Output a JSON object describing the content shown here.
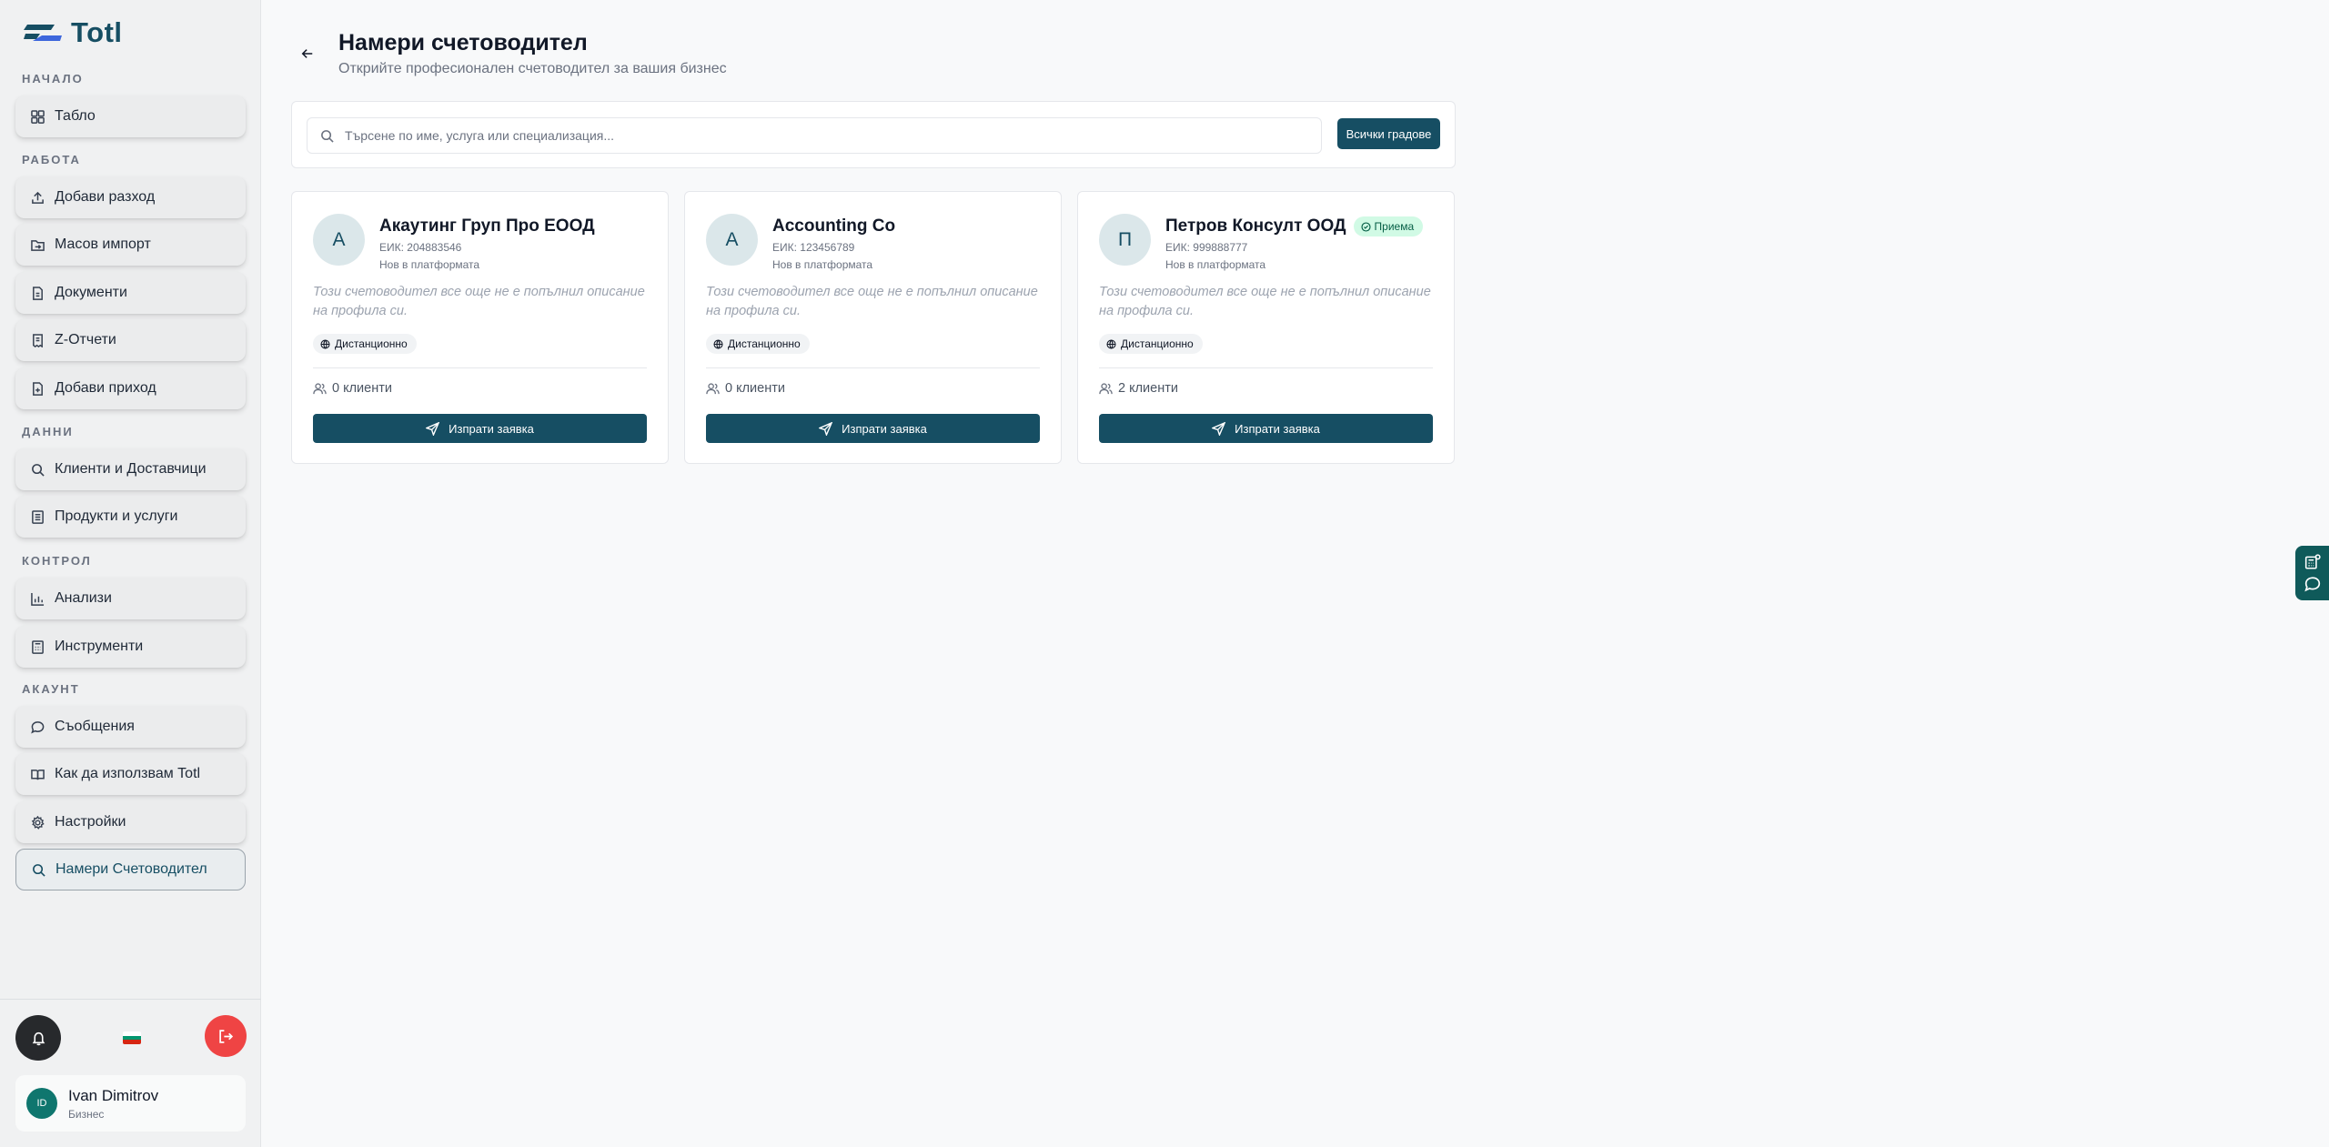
{
  "app": {
    "logo_text": "Totl",
    "brand_color": "#164e63"
  },
  "sidebar": {
    "sections": [
      "НАЧАЛО",
      "РАБОТА",
      "ДАННИ",
      "КОНТРОЛ",
      "АКАУНТ"
    ],
    "items": [
      {
        "label": "Табло",
        "icon": "dashboard-icon"
      },
      {
        "label": "Добави разход",
        "icon": "upload-icon"
      },
      {
        "label": "Масов импорт",
        "icon": "folder-import-icon"
      },
      {
        "label": "Документи",
        "icon": "document-icon"
      },
      {
        "label": "Z-Отчети",
        "icon": "receipt-icon"
      },
      {
        "label": "Добави приход",
        "icon": "document-plus-icon"
      },
      {
        "label": "Клиенти и Доставчици",
        "icon": "search-icon"
      },
      {
        "label": "Продукти и услуги",
        "icon": "list-icon"
      },
      {
        "label": "Анализи",
        "icon": "bar-chart-icon"
      },
      {
        "label": "Инструменти",
        "icon": "calculator-icon"
      },
      {
        "label": "Съобщения",
        "icon": "message-icon"
      },
      {
        "label": "Как да използвам Totl",
        "icon": "book-icon"
      },
      {
        "label": "Настройки",
        "icon": "gear-icon"
      },
      {
        "label": "Намери Счетоводител",
        "icon": "search-icon",
        "active": true
      }
    ]
  },
  "user": {
    "initials": "ID",
    "name": "Ivan Dimitrov",
    "role": "Бизнес"
  },
  "header": {
    "title": "Намери счетоводител",
    "subtitle": "Открийте професионален счетоводител за вашия бизнес"
  },
  "search": {
    "placeholder": "Търсене по име, услуга или специализация...",
    "city_filter": "Всички градове"
  },
  "cards": [
    {
      "initial": "А",
      "name": "Акаутинг Груп Про ЕООД",
      "eik": "ЕИК: 204883546",
      "status": "Нов в платформата",
      "description": "Този счетоводител все още не е попълнил описание на профила си.",
      "tag": "Дистанционно",
      "clients": "0 клиенти",
      "button": "Изпрати заявка"
    },
    {
      "initial": "A",
      "name": "Accounting Co",
      "eik": "ЕИК: 123456789",
      "status": "Нов в платформата",
      "description": "Този счетоводител все още не е попълнил описание на профила си.",
      "tag": "Дистанционно",
      "clients": "0 клиенти",
      "button": "Изпрати заявка"
    },
    {
      "initial": "П",
      "name": "Петров Консулт ООД",
      "badge": "Приема",
      "eik": "ЕИК: 999888777",
      "status": "Нов в платформата",
      "description": "Този счетоводител все още не е попълнил описание на профила си.",
      "tag": "Дистанционно",
      "clients": "2 клиенти",
      "button": "Изпрати заявка"
    }
  ]
}
